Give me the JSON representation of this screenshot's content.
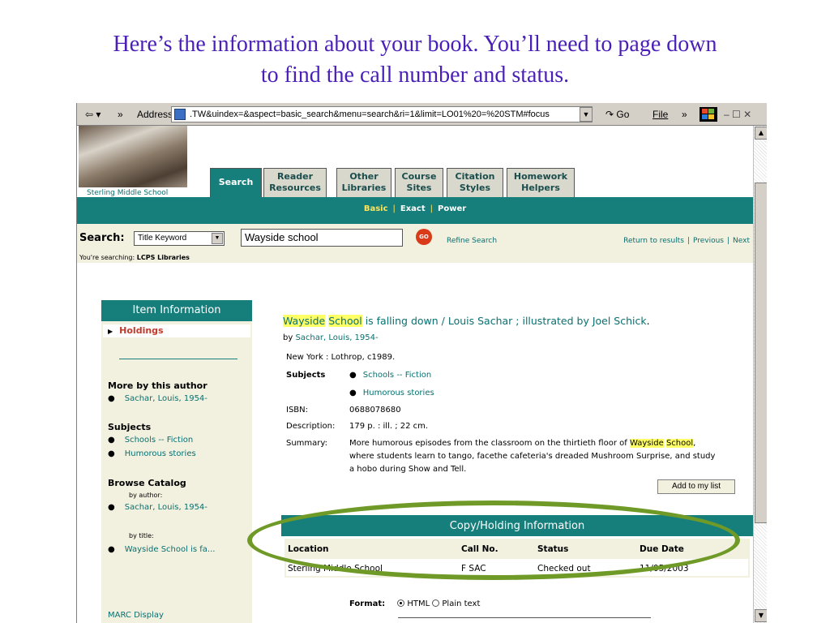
{
  "caption": {
    "line1": "Here’s the information about your book.  You’ll need to page down",
    "line2": "to find the call number and status."
  },
  "browser": {
    "back_glyph": "⇦ ▾",
    "more_glyph": "»",
    "address_label": "Address",
    "address_value": ".TW&uindex=&aspect=basic_search&menu=search&ri=1&limit=LO01%20=%20STM#focus",
    "go_label": "Go",
    "file_menu": "File",
    "window_controls": "– ☐ ✕"
  },
  "library": {
    "name": "Sterling Middle School",
    "tabs": [
      {
        "line1": "Search",
        "line2": ""
      },
      {
        "line1": "Reader",
        "line2": "Resources"
      },
      {
        "line1": "Other",
        "line2": "Libraries"
      },
      {
        "line1": "Course",
        "line2": "Sites"
      },
      {
        "line1": "Citation",
        "line2": "Styles"
      },
      {
        "line1": "Homework",
        "line2": "Helpers"
      }
    ],
    "search_modes": [
      "Basic",
      "Exact",
      "Power"
    ],
    "search_label": "Search:",
    "search_type": "Title Keyword",
    "search_query": "Wayside school",
    "go_button": "GO",
    "refine": "Refine Search",
    "nav_links": [
      "Return to results",
      "Previous",
      "Next"
    ],
    "scope_prefix": "You're searching:",
    "scope_value": "LCPS Libraries"
  },
  "sidebar": {
    "header": "Item Information",
    "holdings": "Holdings",
    "more_by_author_heading": "More by this author",
    "more_by_author": "Sachar, Louis, 1954-",
    "subjects_heading": "Subjects",
    "subjects": [
      "Schools -- Fiction",
      "Humorous stories"
    ],
    "browse_heading": "Browse Catalog",
    "by_author_label": "by author:",
    "by_author_value": "Sachar, Louis, 1954-",
    "by_title_label": "by title:",
    "by_title_value": "Wayside School is fa...",
    "marc": "MARC Display"
  },
  "record": {
    "title_hl1": "Wayside",
    "title_hl2": "School",
    "title_rest": " is falling down / Louis Sachar ; illustrated by Joel Schick",
    "title_period": ".",
    "by_prefix": "by",
    "author": "Sachar, Louis, 1954-",
    "publisher": "New York : Lothrop, c1989.",
    "subjects_label": "Subjects",
    "subjects": [
      "Schools -- Fiction",
      "Humorous stories"
    ],
    "isbn_label": "ISBN:",
    "isbn": "0688078680",
    "description_label": "Description:",
    "description": "179 p. : ill. ; 22 cm.",
    "summary_label": "Summary:",
    "summary_pre": "More humorous episodes from the classroom on the thirtieth floor of ",
    "summary_hl1": "Wayside",
    "summary_hl2": "School",
    "summary_post": ", where students learn to tango, facethe cafeteria's dreaded Mushroom Surprise, and study a hobo during Show and Tell.",
    "add_to_list": "Add to my list"
  },
  "holdings": {
    "header": "Copy/Holding Information",
    "columns": [
      "Location",
      "Call No.",
      "Status",
      "Due Date"
    ],
    "rows": [
      [
        "Sterling Middle School",
        "F SAC",
        "Checked out",
        "11/05/2003"
      ]
    ]
  },
  "format": {
    "label": "Format:",
    "options": [
      "HTML",
      "Plain text"
    ],
    "selected": "HTML"
  },
  "colors": {
    "teal": "#167f7c",
    "caption": "#4a1fb8",
    "highlight": "#ffff66",
    "annotation_ellipse": "#6f9a27"
  }
}
